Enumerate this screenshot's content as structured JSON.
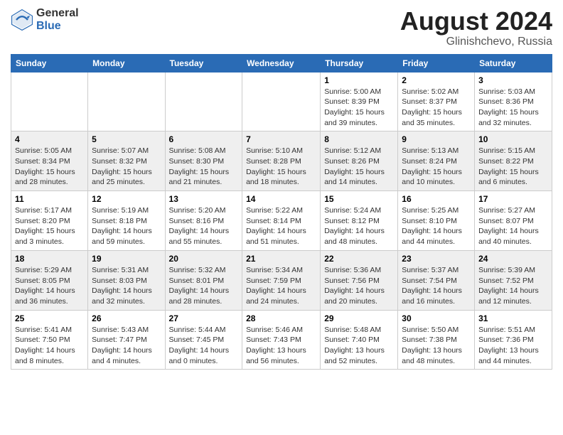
{
  "header": {
    "logo_general": "General",
    "logo_blue": "Blue",
    "title": "August 2024",
    "location": "Glinishchevo, Russia"
  },
  "weekdays": [
    "Sunday",
    "Monday",
    "Tuesday",
    "Wednesday",
    "Thursday",
    "Friday",
    "Saturday"
  ],
  "weeks": [
    [
      {
        "day": "",
        "info": ""
      },
      {
        "day": "",
        "info": ""
      },
      {
        "day": "",
        "info": ""
      },
      {
        "day": "",
        "info": ""
      },
      {
        "day": "1",
        "info": "Sunrise: 5:00 AM\nSunset: 8:39 PM\nDaylight: 15 hours\nand 39 minutes."
      },
      {
        "day": "2",
        "info": "Sunrise: 5:02 AM\nSunset: 8:37 PM\nDaylight: 15 hours\nand 35 minutes."
      },
      {
        "day": "3",
        "info": "Sunrise: 5:03 AM\nSunset: 8:36 PM\nDaylight: 15 hours\nand 32 minutes."
      }
    ],
    [
      {
        "day": "4",
        "info": "Sunrise: 5:05 AM\nSunset: 8:34 PM\nDaylight: 15 hours\nand 28 minutes."
      },
      {
        "day": "5",
        "info": "Sunrise: 5:07 AM\nSunset: 8:32 PM\nDaylight: 15 hours\nand 25 minutes."
      },
      {
        "day": "6",
        "info": "Sunrise: 5:08 AM\nSunset: 8:30 PM\nDaylight: 15 hours\nand 21 minutes."
      },
      {
        "day": "7",
        "info": "Sunrise: 5:10 AM\nSunset: 8:28 PM\nDaylight: 15 hours\nand 18 minutes."
      },
      {
        "day": "8",
        "info": "Sunrise: 5:12 AM\nSunset: 8:26 PM\nDaylight: 15 hours\nand 14 minutes."
      },
      {
        "day": "9",
        "info": "Sunrise: 5:13 AM\nSunset: 8:24 PM\nDaylight: 15 hours\nand 10 minutes."
      },
      {
        "day": "10",
        "info": "Sunrise: 5:15 AM\nSunset: 8:22 PM\nDaylight: 15 hours\nand 6 minutes."
      }
    ],
    [
      {
        "day": "11",
        "info": "Sunrise: 5:17 AM\nSunset: 8:20 PM\nDaylight: 15 hours\nand 3 minutes."
      },
      {
        "day": "12",
        "info": "Sunrise: 5:19 AM\nSunset: 8:18 PM\nDaylight: 14 hours\nand 59 minutes."
      },
      {
        "day": "13",
        "info": "Sunrise: 5:20 AM\nSunset: 8:16 PM\nDaylight: 14 hours\nand 55 minutes."
      },
      {
        "day": "14",
        "info": "Sunrise: 5:22 AM\nSunset: 8:14 PM\nDaylight: 14 hours\nand 51 minutes."
      },
      {
        "day": "15",
        "info": "Sunrise: 5:24 AM\nSunset: 8:12 PM\nDaylight: 14 hours\nand 48 minutes."
      },
      {
        "day": "16",
        "info": "Sunrise: 5:25 AM\nSunset: 8:10 PM\nDaylight: 14 hours\nand 44 minutes."
      },
      {
        "day": "17",
        "info": "Sunrise: 5:27 AM\nSunset: 8:07 PM\nDaylight: 14 hours\nand 40 minutes."
      }
    ],
    [
      {
        "day": "18",
        "info": "Sunrise: 5:29 AM\nSunset: 8:05 PM\nDaylight: 14 hours\nand 36 minutes."
      },
      {
        "day": "19",
        "info": "Sunrise: 5:31 AM\nSunset: 8:03 PM\nDaylight: 14 hours\nand 32 minutes."
      },
      {
        "day": "20",
        "info": "Sunrise: 5:32 AM\nSunset: 8:01 PM\nDaylight: 14 hours\nand 28 minutes."
      },
      {
        "day": "21",
        "info": "Sunrise: 5:34 AM\nSunset: 7:59 PM\nDaylight: 14 hours\nand 24 minutes."
      },
      {
        "day": "22",
        "info": "Sunrise: 5:36 AM\nSunset: 7:56 PM\nDaylight: 14 hours\nand 20 minutes."
      },
      {
        "day": "23",
        "info": "Sunrise: 5:37 AM\nSunset: 7:54 PM\nDaylight: 14 hours\nand 16 minutes."
      },
      {
        "day": "24",
        "info": "Sunrise: 5:39 AM\nSunset: 7:52 PM\nDaylight: 14 hours\nand 12 minutes."
      }
    ],
    [
      {
        "day": "25",
        "info": "Sunrise: 5:41 AM\nSunset: 7:50 PM\nDaylight: 14 hours\nand 8 minutes."
      },
      {
        "day": "26",
        "info": "Sunrise: 5:43 AM\nSunset: 7:47 PM\nDaylight: 14 hours\nand 4 minutes."
      },
      {
        "day": "27",
        "info": "Sunrise: 5:44 AM\nSunset: 7:45 PM\nDaylight: 14 hours\nand 0 minutes."
      },
      {
        "day": "28",
        "info": "Sunrise: 5:46 AM\nSunset: 7:43 PM\nDaylight: 13 hours\nand 56 minutes."
      },
      {
        "day": "29",
        "info": "Sunrise: 5:48 AM\nSunset: 7:40 PM\nDaylight: 13 hours\nand 52 minutes."
      },
      {
        "day": "30",
        "info": "Sunrise: 5:50 AM\nSunset: 7:38 PM\nDaylight: 13 hours\nand 48 minutes."
      },
      {
        "day": "31",
        "info": "Sunrise: 5:51 AM\nSunset: 7:36 PM\nDaylight: 13 hours\nand 44 minutes."
      }
    ]
  ]
}
